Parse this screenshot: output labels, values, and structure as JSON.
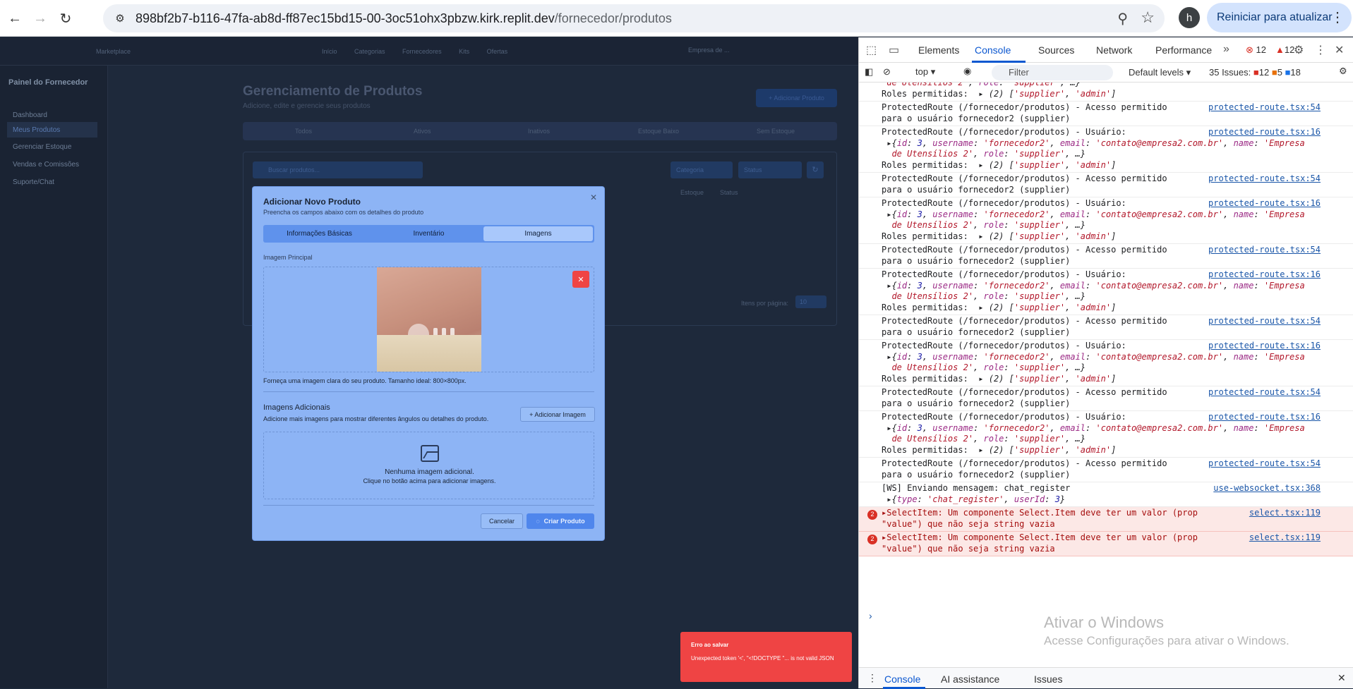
{
  "browser": {
    "url_host": "898bf2b7-b116-47fa-ab8d-ff87ec15bd15-00-3oc51ohx3pbzw.kirk.replit.dev",
    "url_path": "/fornecedor/produtos",
    "profile_initial": "h",
    "update_label": "Reiniciar para atualizar"
  },
  "app": {
    "logo": "Marketplace",
    "nav_links": "Início Categorias Fornecedores Kits Ofertas",
    "company": "Empresa de ...",
    "sidebar_title": "Painel do Fornecedor",
    "sidebar_items": [
      "Dashboard",
      "Meus Produtos",
      "Gerenciar Estoque",
      "Vendas e Comissões",
      "Suporte/Chat"
    ],
    "page_title": "Gerenciamento de Produtos",
    "page_subtitle": "Adicione, edite e gerencie seus produtos",
    "add_product": "+ Adicionar Produto",
    "tabs": [
      "Todos",
      "Ativos",
      "Inativos",
      "Estoque Baixo",
      "Sem Estoque"
    ],
    "search_placeholder": "Buscar produtos...",
    "filter_category": "Categoria",
    "filter_status": "Status",
    "col_stock": "Estoque",
    "col_status": "Status",
    "per_page_label": "Itens por página:",
    "per_page_value": "10"
  },
  "dialog": {
    "title": "Adicionar Novo Produto",
    "subtitle": "Preencha os campos abaixo com os detalhes do produto",
    "tabs": [
      "Informações Básicas",
      "Inventário",
      "Imagens"
    ],
    "active_tab": "Imagens",
    "main_image_label": "Imagem Principal",
    "main_image_hint": "Forneça uma imagem clara do seu produto. Tamanho ideal: 800×800px.",
    "extra_title": "Imagens Adicionais",
    "extra_subtitle": "Adicione mais imagens para mostrar diferentes ângulos ou detalhes do produto.",
    "add_image_label": "+ Adicionar Imagem",
    "no_images": "Nenhuma imagem adicional.",
    "no_images_hint": "Clique no botão acima para adicionar imagens.",
    "cancel_label": "Cancelar",
    "create_label": "Criar Produto"
  },
  "toast": {
    "title": "Erro ao salvar",
    "message": "Unexpected token '<', \"<!DOCTYPE \"... is not valid JSON"
  },
  "devtools": {
    "tabs": [
      "Elements",
      "Console",
      "Sources",
      "Network",
      "Performance"
    ],
    "error_count": "12",
    "warning_count": "12",
    "context": "top",
    "filter_placeholder": "Filter",
    "levels": "Default levels",
    "issues_label": "35 Issues:",
    "issues_errors": "12",
    "issues_warnings": "5",
    "issues_info": "18",
    "drawer_tabs": [
      "Console",
      "AI assistance",
      "Issues"
    ],
    "watermark_title": "Ativar o Windows",
    "watermark_sub": "Acesse Configurações para ativar o Windows.",
    "src_route54": "protected-route.tsx:54",
    "src_route16": "protected-route.tsx:16",
    "src_ws": "use-websocket.tsx:368",
    "src_select": "select.tsx:119",
    "msg_allowed": "ProtectedRoute (/fornecedor/produtos) - Acesso permitido\npara o usuário fornecedor2 (supplier)",
    "msg_user": "ProtectedRoute (/fornecedor/produtos) - Usuário:",
    "msg_ws": "[WS] Enviando mensagem: chat_register",
    "msg_select": "SelectItem: Um componente Select.Item deve ter um valor (prop\n\"value\") que não seja string vazia",
    "select_count": "2"
  },
  "colors": {
    "danger": "#ef4444",
    "dialog_bg": "#8db4f5",
    "link": "#1a56a8"
  }
}
